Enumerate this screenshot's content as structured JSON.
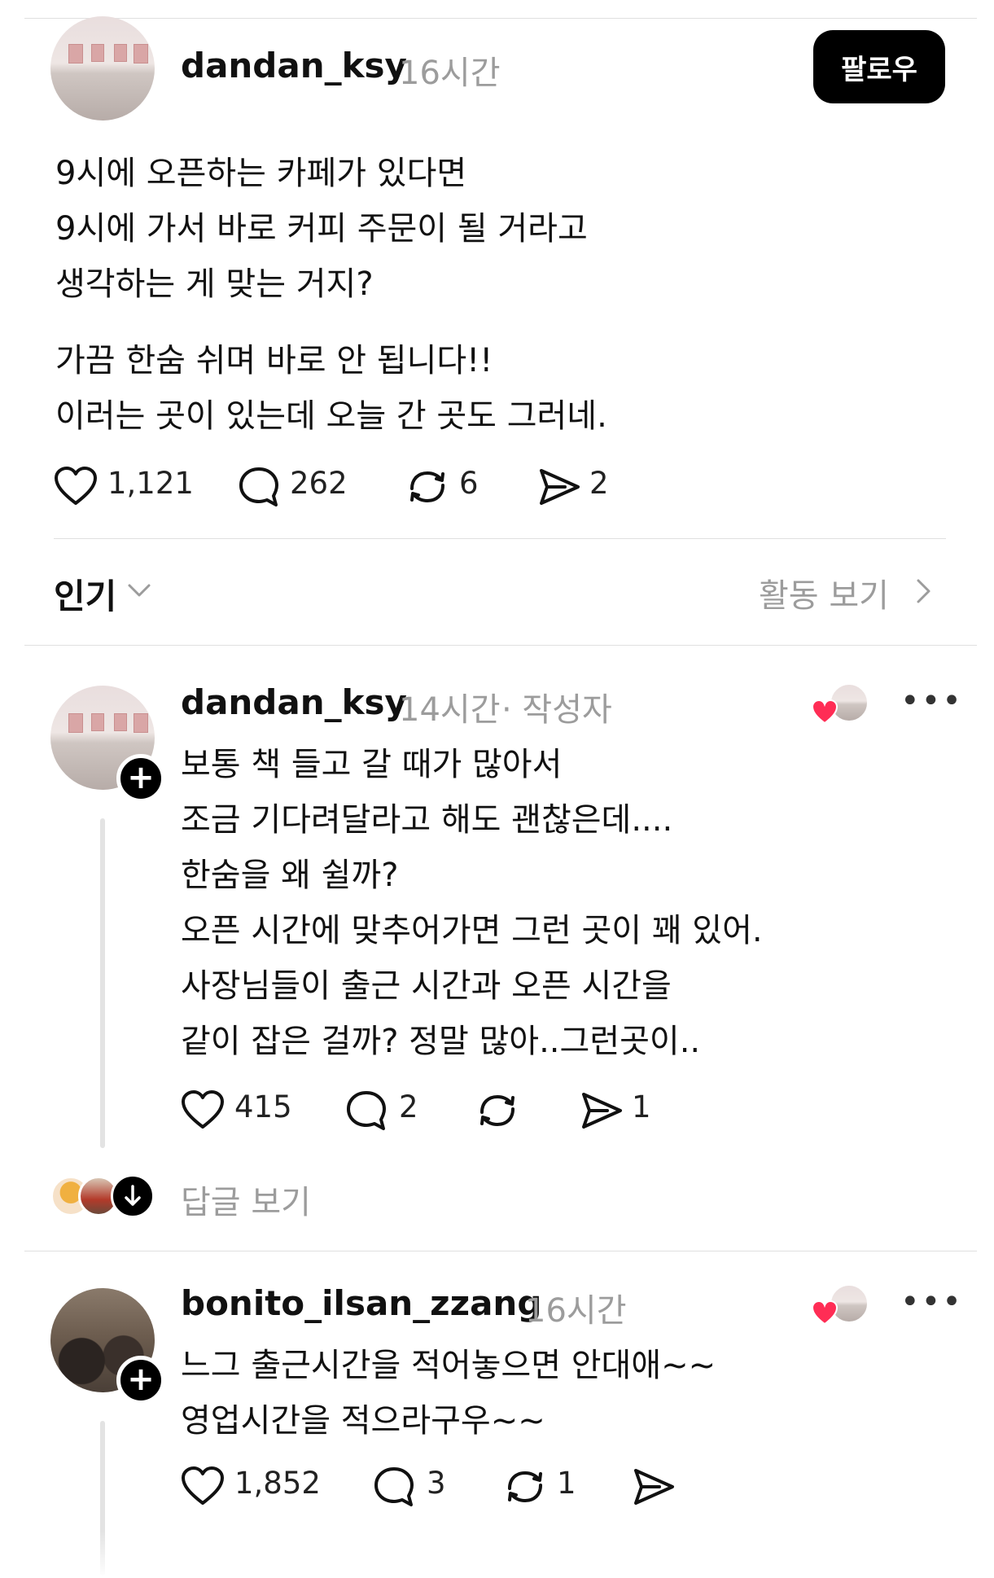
{
  "post": {
    "username": "dandan_ksy",
    "time": "16시간",
    "follow_label": "팔로우",
    "paragraph1": [
      "9시에 오픈하는 카페가 있다면",
      "9시에 가서 바로 커피 주문이 될 거라고",
      "생각하는 게 맞는 거지?"
    ],
    "paragraph2": [
      "가끔 한숨 쉬며 바로 안 됩니다!!",
      "이러는 곳이 있는데 오늘 간 곳도 그러네."
    ],
    "likes": "1,121",
    "comments": "262",
    "reposts": "6",
    "shares": "2"
  },
  "sort": {
    "label": "인기",
    "activity_label": "활동 보기"
  },
  "replies": [
    {
      "username": "dandan_ksy",
      "time": "14시간",
      "author_tag": "· 작성자",
      "lines": [
        "보통 책 들고 갈 때가 많아서",
        "조금 기다려달라고 해도 괜찮은데....",
        "한숨을 왜 쉴까?",
        "오픈 시간에 맞추어가면 그런 곳이 꽤 있어.",
        "사장님들이 출근 시간과 오픈 시간을",
        "같이 잡은 걸까? 정말 많아..그런곳이.."
      ],
      "likes": "415",
      "comments": "2",
      "reposts": "",
      "shares": "1",
      "view_replies": "답글 보기"
    },
    {
      "username": "bonito_ilsan_zzang",
      "time": "16시간",
      "lines": [
        "느그 출근시간을 적어놓으면 안대애~~",
        "영업시간을 적으라구우~~"
      ],
      "likes": "1,852",
      "comments": "3",
      "reposts": "1",
      "shares": ""
    }
  ],
  "icons": {
    "like": "heart-outline-icon",
    "comment": "speech-bubble-icon",
    "repost": "repost-arrows-icon",
    "share": "send-arrow-icon",
    "more": "more-dots-icon",
    "follow_plus": "plus-icon",
    "view_replies": "arrow-down-icon",
    "sort": "chevron-down-icon",
    "activity": "chevron-right-icon",
    "author_liked": "red-heart-icon"
  },
  "colors": {
    "text": "#111111",
    "muted": "#9c9c9c",
    "divider": "#e0e0e0",
    "follow_bg": "#000000",
    "heart_red": "#ff2d55"
  }
}
